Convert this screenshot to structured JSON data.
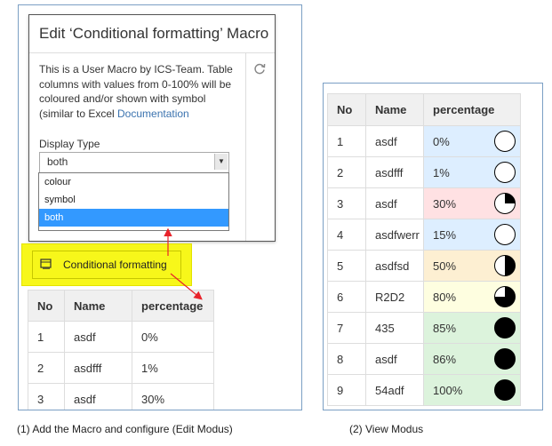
{
  "edit": {
    "dialog_title": "Edit ‘Conditional formatting’ Macro",
    "description_before_link": "This is a User Macro by ICS-Team. Table columns with values from 0-100% will be coloured and/or shown with symbol (similar to Excel ",
    "documentation_link": "Documentation",
    "display_type_label": "Display Type",
    "selected_value": "both",
    "options": [
      "colour",
      "symbol",
      "both"
    ],
    "macro_label": "Conditional formatting",
    "table": {
      "headers": [
        "No",
        "Name",
        "percentage"
      ],
      "rows": [
        {
          "no": "1",
          "name": "asdf",
          "pct": "0%"
        },
        {
          "no": "2",
          "name": "asdfff",
          "pct": "1%"
        },
        {
          "no": "3",
          "name": "asdf",
          "pct": "30%"
        }
      ]
    }
  },
  "view": {
    "table": {
      "headers": [
        "No",
        "Name",
        "percentage"
      ],
      "rows": [
        {
          "no": "1",
          "name": "asdf",
          "pct": "0%",
          "bg": "#ddeeff",
          "fill": 0
        },
        {
          "no": "2",
          "name": "asdfff",
          "pct": "1%",
          "bg": "#ddeeff",
          "fill": 0
        },
        {
          "no": "3",
          "name": "asdf",
          "pct": "30%",
          "bg": "#ffe1e3",
          "fill": 0.25
        },
        {
          "no": "4",
          "name": "asdfwerr",
          "pct": "15%",
          "bg": "#ddeeff",
          "fill": 0
        },
        {
          "no": "5",
          "name": "asdfsd",
          "pct": "50%",
          "bg": "#fdefd2",
          "fill": 0.5
        },
        {
          "no": "6",
          "name": "R2D2",
          "pct": "80%",
          "bg": "#fefee0",
          "fill": 0.75
        },
        {
          "no": "7",
          "name": "435",
          "pct": "85%",
          "bg": "#dcf3dc",
          "fill": 1
        },
        {
          "no": "8",
          "name": "asdf",
          "pct": "86%",
          "bg": "#dcf3dc",
          "fill": 1
        },
        {
          "no": "9",
          "name": "54adf",
          "pct": "100%",
          "bg": "#dcf3dc",
          "fill": 1
        }
      ]
    }
  },
  "captions": {
    "left": "(1) Add the Macro and configure (Edit Modus)",
    "right": "(2) View Modus"
  },
  "colors": {
    "highlight": "#f7f71a",
    "selected_option": "#3399ff",
    "link": "#3b73af",
    "arrow": "#e8232b"
  },
  "icons": {
    "refresh": "refresh-icon",
    "macro": "macro-placeholder-icon",
    "dropdown": "chevron-down-icon"
  }
}
